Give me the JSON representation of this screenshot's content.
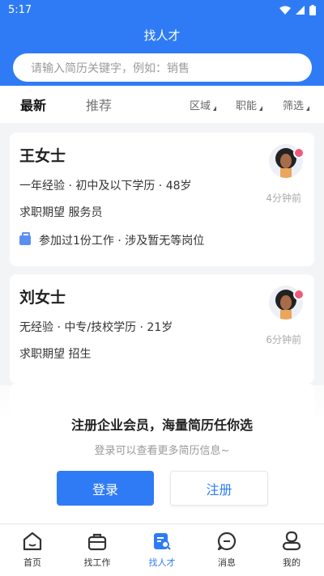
{
  "status": {
    "time": "5:17"
  },
  "header": {
    "title": "找人才"
  },
  "search": {
    "placeholder": "请输入简历关键字，例如：销售"
  },
  "tabs": {
    "latest": "最新",
    "recommend": "推荐"
  },
  "filters": {
    "area": "区域",
    "role": "职能",
    "filter": "筛选"
  },
  "cards": [
    {
      "name": "王女士",
      "meta": "一年经验 · 初中及以下学历 · 48岁",
      "expect": "求职期望 服务员",
      "work": "参加过1份工作 · 涉及暂无等岗位",
      "time": "4分钟前"
    },
    {
      "name": "刘女士",
      "meta": "无经验 · 中专/技校学历 · 21岁",
      "expect": "求职期望 招生",
      "time": "6分钟前"
    }
  ],
  "prompt": {
    "title": "注册企业会员，海量简历任你选",
    "subtitle": "登录可以查看更多简历信息~",
    "login": "登录",
    "register": "注册"
  },
  "nav": {
    "home": "首页",
    "jobs": "找工作",
    "talent": "找人才",
    "messages": "消息",
    "mine": "我的"
  },
  "colors": {
    "primary": "#2f7bf5",
    "badge": "#f05a7a"
  }
}
